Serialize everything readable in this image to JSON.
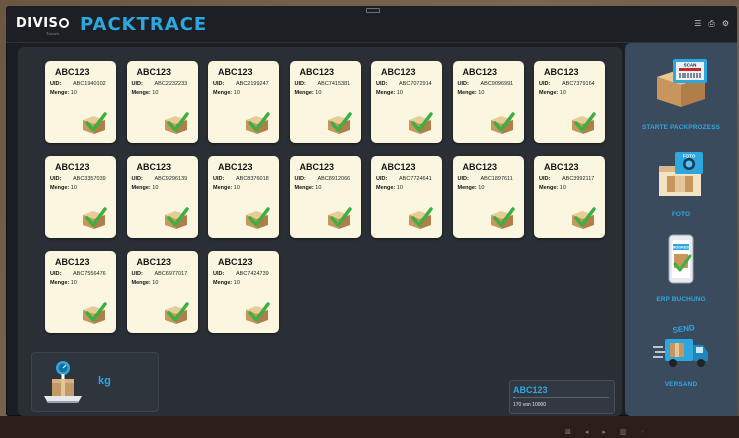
{
  "header": {
    "brand": "DIVIS",
    "brand_sub": "Touch",
    "app_title": "PACKTRACE",
    "icons": [
      "menu-icon",
      "printer-icon",
      "settings-icon"
    ],
    "icon_glyphs": [
      "☰",
      "⎙",
      "⚙"
    ]
  },
  "cards": [
    {
      "title": "ABC123",
      "uid_label": "UID:",
      "uid": "ABC1940102",
      "menge_label": "Menge:",
      "menge": "10"
    },
    {
      "title": "ABC123",
      "uid_label": "UID:",
      "uid": "ABC2232233",
      "menge_label": "Menge:",
      "menge": "10"
    },
    {
      "title": "ABC123",
      "uid_label": "UID:",
      "uid": "ABC2199247",
      "menge_label": "Menge:",
      "menge": "10"
    },
    {
      "title": "ABC123",
      "uid_label": "UID:",
      "uid": "ABC7415381",
      "menge_label": "Menge:",
      "menge": "10"
    },
    {
      "title": "ABC123",
      "uid_label": "UID:",
      "uid": "ABC7072914",
      "menge_label": "Menge:",
      "menge": "10"
    },
    {
      "title": "ABC123",
      "uid_label": "UID:",
      "uid": "ABC9096991",
      "menge_label": "Menge:",
      "menge": "10"
    },
    {
      "title": "ABC123",
      "uid_label": "UID:",
      "uid": "ABC7379164",
      "menge_label": "Menge:",
      "menge": "10"
    },
    {
      "title": "ABC123",
      "uid_label": "UID:",
      "uid": "ABC3357039",
      "menge_label": "Menge:",
      "menge": "10"
    },
    {
      "title": "ABC123",
      "uid_label": "UID:",
      "uid": "ABC9296139",
      "menge_label": "Menge:",
      "menge": "10"
    },
    {
      "title": "ABC123",
      "uid_label": "UID:",
      "uid": "ABC8376018",
      "menge_label": "Menge:",
      "menge": "10"
    },
    {
      "title": "ABC123",
      "uid_label": "UID:",
      "uid": "ABC8912066",
      "menge_label": "Menge:",
      "menge": "10"
    },
    {
      "title": "ABC123",
      "uid_label": "UID:",
      "uid": "ABC7724641",
      "menge_label": "Menge:",
      "menge": "10"
    },
    {
      "title": "ABC123",
      "uid_label": "UID:",
      "uid": "ABC1897611",
      "menge_label": "Menge:",
      "menge": "10"
    },
    {
      "title": "ABC123",
      "uid_label": "UID:",
      "uid": "ABC3992117",
      "menge_label": "Menge:",
      "menge": "10"
    },
    {
      "title": "ABC123",
      "uid_label": "UID:",
      "uid": "ABC7556476",
      "menge_label": "Menge:",
      "menge": "10"
    },
    {
      "title": "ABC123",
      "uid_label": "UID:",
      "uid": "ABC6977017",
      "menge_label": "Menge:",
      "menge": "10"
    },
    {
      "title": "ABC123",
      "uid_label": "UID:",
      "uid": "ABC7424739",
      "menge_label": "Menge:",
      "menge": "10"
    }
  ],
  "scale": {
    "unit": "kg",
    "icon": "scale-icon"
  },
  "progress": {
    "title": "ABC123",
    "text": "170 von 10000",
    "fraction": 0.017
  },
  "sidebar": {
    "items": [
      {
        "label": "STARTE PACKPROZESS",
        "icon": "scan-package-icon",
        "badge": "SCAN"
      },
      {
        "label": "FOTO",
        "icon": "camera-package-icon",
        "badge": "FOTO"
      },
      {
        "label": "ERP BUCHUNG",
        "icon": "booked-phone-icon",
        "badge": "BOOKED"
      },
      {
        "label": "VERSAND",
        "icon": "send-truck-icon",
        "badge": "SEND"
      }
    ]
  },
  "footer": {
    "controls": [
      "⊠",
      "◂",
      "▸",
      "▥",
      "◦"
    ]
  },
  "colors": {
    "accent": "#2ea7e0",
    "card_bg": "#fbf6df",
    "panel_bg": "#2a2f35",
    "sidebar_bg": "#3b4b5e"
  }
}
